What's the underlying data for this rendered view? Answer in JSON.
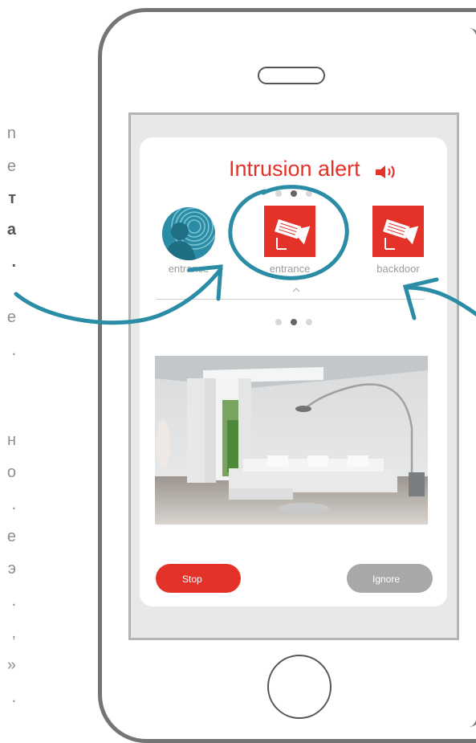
{
  "left_edge_chars": [
    {
      "text": "n",
      "dark": false
    },
    {
      "text": "e",
      "dark": false
    },
    {
      "text": "т",
      "dark": true
    },
    {
      "text": "a",
      "dark": true
    },
    {
      "text": ".",
      "dark": true
    },
    {
      "text": "e",
      "dark": false
    },
    {
      "text": ".",
      "dark": false
    },
    {
      "text": "н",
      "dark": false
    },
    {
      "text": "о",
      "dark": false
    },
    {
      "text": ".",
      "dark": false
    },
    {
      "text": "e",
      "dark": false
    },
    {
      "text": "э",
      "dark": false
    },
    {
      "text": ".",
      "dark": false
    },
    {
      "text": ",",
      "dark": false
    },
    {
      "text": "»",
      "dark": false
    },
    {
      "text": ".",
      "dark": false
    }
  ],
  "alert": {
    "title": "Intrusion alert",
    "icon": "speaker-sound-icon",
    "color": "#e53228"
  },
  "pager_top": {
    "count": 3,
    "active": 1
  },
  "pager_mid": {
    "count": 3,
    "active": 1
  },
  "cameras": [
    {
      "label": "entrance",
      "icon": "user-avatar-icon"
    },
    {
      "label": "entrance",
      "icon": "security-camera-icon"
    },
    {
      "label": "backdoor",
      "icon": "security-camera-icon"
    }
  ],
  "buttons": {
    "stop_label": "Stop",
    "ignore_label": "Ignore"
  },
  "colors": {
    "accent": "#e53228",
    "teal_annotation": "#2a8da5",
    "ignore_grey": "#a8a8a8"
  }
}
